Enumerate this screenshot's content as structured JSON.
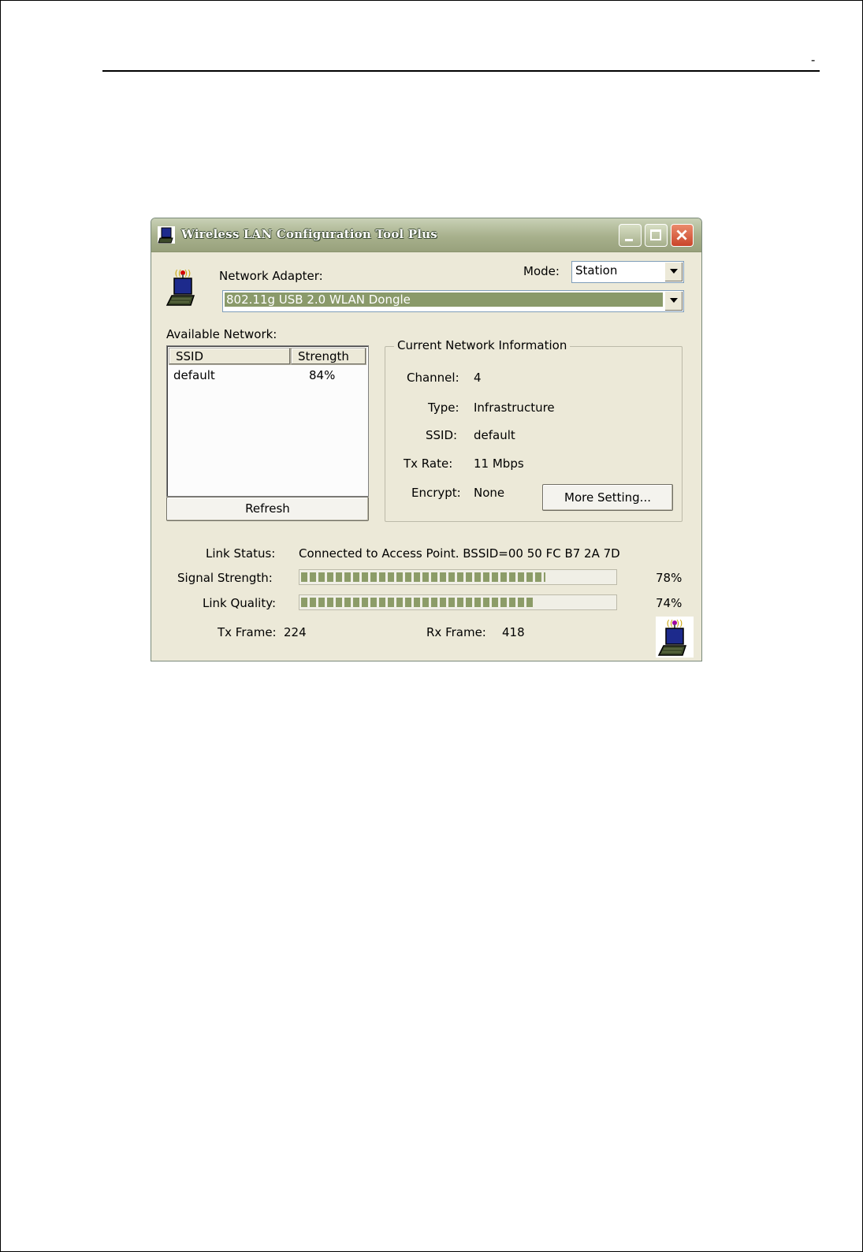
{
  "page": {
    "header_mark": "-"
  },
  "window": {
    "title": "Wireless LAN Configuration Tool Plus",
    "mode_label": "Mode:",
    "mode_value": "Station",
    "adapter_label": "Network Adapter:",
    "adapter_value": "802.11g USB 2.0 WLAN Dongle",
    "available_label": "Available Network:",
    "columns": [
      "SSID",
      "Strength"
    ],
    "networks": [
      {
        "ssid": "default",
        "strength": "84%"
      }
    ],
    "refresh_label": "Refresh",
    "current_info": {
      "title": "Current Network Information",
      "channel_label": "Channel:",
      "channel_value": "4",
      "type_label": "Type:",
      "type_value": "Infrastructure",
      "ssid_label": "SSID:",
      "ssid_value": "default",
      "txrate_label": "Tx Rate:",
      "txrate_value": "11 Mbps",
      "encrypt_label": "Encrypt:",
      "encrypt_value": "None",
      "more_setting_label": "More Setting..."
    },
    "status": {
      "link_status_label": "Link Status:",
      "link_status_value": "Connected to Access Point. BSSID=00 50 FC B7 2A 7D",
      "signal_label": "Signal Strength:",
      "signal_value": "78%",
      "signal_fraction": 0.78,
      "quality_label": "Link Quality:",
      "quality_value": "74%",
      "quality_fraction": 0.74,
      "tx_frame_label": "Tx Frame:",
      "tx_frame_value": "224",
      "rx_frame_label": "Rx Frame:",
      "rx_frame_value": "418"
    },
    "icons": {
      "app": "wireless-computer-icon",
      "adapter": "wireless-computer-icon",
      "tray": "wireless-computer-icon"
    }
  },
  "colors": {
    "window_bg": "#ece9d8",
    "titlebar": "#a7b08c",
    "progress_fill": "#8c9c68",
    "selection": "#8a9a6a",
    "close_button": "#c9452a"
  }
}
